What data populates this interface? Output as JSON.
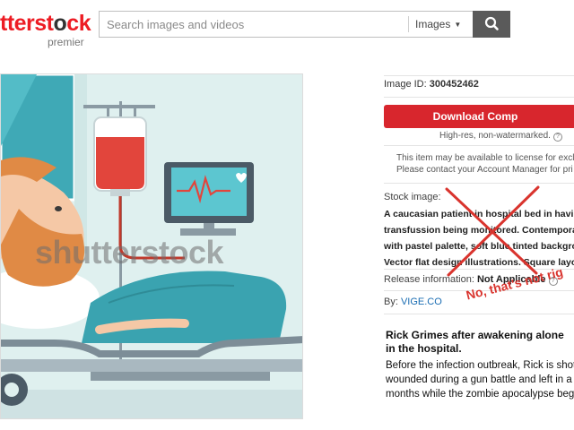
{
  "header": {
    "logo_part_red": "tterst",
    "logo_part_dark": "o",
    "logo_part_end": "ck",
    "logo_sub": "premier",
    "search": {
      "placeholder": "Search images and videos",
      "type_label": "Images",
      "type_caret": "▼",
      "button_icon": "search-icon"
    }
  },
  "image": {
    "watermark": "shutterstock"
  },
  "panel": {
    "image_id_label": "Image ID:",
    "image_id": "300452462",
    "download_label": "Download Comp",
    "hires_note": "High-res, non-watermarked.",
    "help_glyph": "?",
    "license_line1": "This item may be available to license for exclusi",
    "license_line2": "Please contact your Account Manager for pri",
    "stock_label": "Stock image:",
    "description_lines": [
      "A caucasian patient in hospital bed in having",
      "transfussion being monitored. Contemporar",
      "with pastel palette, soft blue tinted backgrou",
      "Vector flat design illustrations. Square layou"
    ],
    "release_label": "Release information:",
    "release_value": "Not Applicable",
    "by_label": "By:",
    "author": "VIGE.CO"
  },
  "caption": {
    "title_lines": [
      "Rick Grimes after awakening alone",
      "in the hospital."
    ],
    "body_lines": [
      "Before the infection outbreak, Rick is shot a",
      "wounded during a gun battle and left in a co",
      "months while the zombie apocalypse begu"
    ]
  },
  "annotation": {
    "text": "No, that's not rig",
    "color": "#d9342e"
  },
  "colors": {
    "brand_red": "#ed1c24",
    "download_red": "#d8262d",
    "link_blue": "#1a6db3",
    "illustration_bg": "#dff0ef"
  }
}
